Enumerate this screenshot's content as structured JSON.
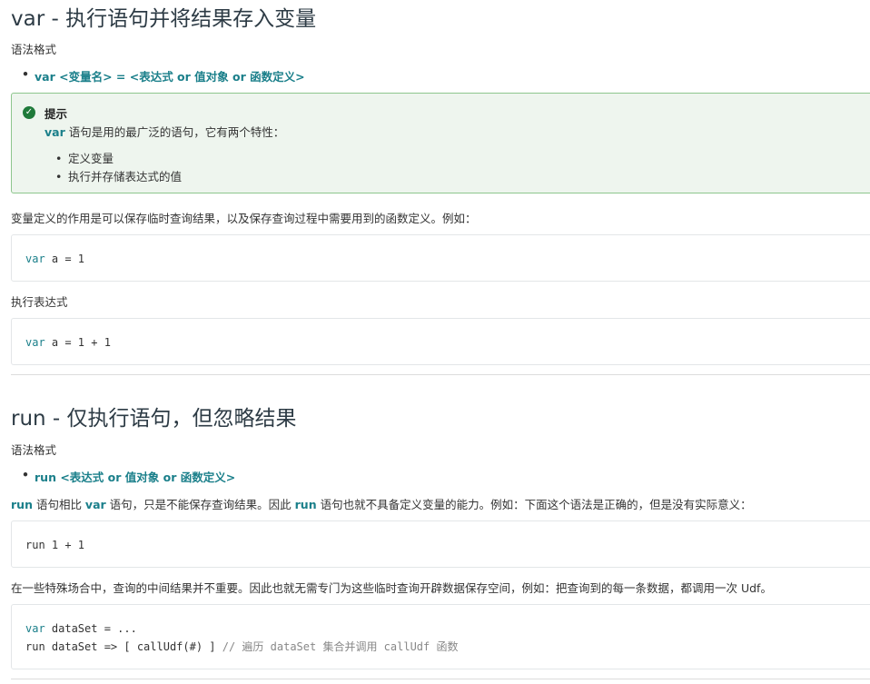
{
  "var_section": {
    "title": "var - 执行语句并将结果存入变量",
    "syntax_label": "语法格式",
    "syntax_kw": "var",
    "syntax_rest": " <变量名> = <表达式 or 值对象 or 函数定义>",
    "tip": {
      "icon": "check-circle-icon",
      "title": "提示",
      "desc_kw": "var",
      "desc_rest": " 语句是用的最广泛的语句，它有两个特性：",
      "items": [
        "定义变量",
        "执行并存储表达式的值"
      ]
    },
    "para1": "变量定义的作用是可以保存临时查询结果，以及保存查询过程中需要用到的函数定义。例如：",
    "code1": {
      "kw": "var",
      "rest": " a = 1"
    },
    "para2": "执行表达式",
    "code2": {
      "kw": "var",
      "rest": " a = 1 + 1"
    }
  },
  "run_section": {
    "title": "run - 仅执行语句，但忽略结果",
    "syntax_label": "语法格式",
    "syntax_kw": "run",
    "syntax_rest": " <表达式 or 值对象 or 函数定义>",
    "para1_parts": [
      "run",
      " 语句相比 ",
      "var",
      " 语句，只是不能保存查询结果。因此 ",
      "run",
      " 语句也就不具备定义变量的能力。例如：下面这个语法是正确的，但是没有实际意义："
    ],
    "code1": "run 1 + 1",
    "para2": "在一些特殊场合中，查询的中间结果并不重要。因此也就无需专门为这些临时查询开辟数据保存空间，例如：把查询到的每一条数据，都调用一次 Udf。",
    "code2": {
      "line1_kw": "var",
      "line1_rest": " dataSet = ...",
      "line2_code": "run dataSet => [ callUdf(#) ] ",
      "line2_comment": "// 遍历 dataSet 集合并调用 callUdf 函数"
    }
  }
}
